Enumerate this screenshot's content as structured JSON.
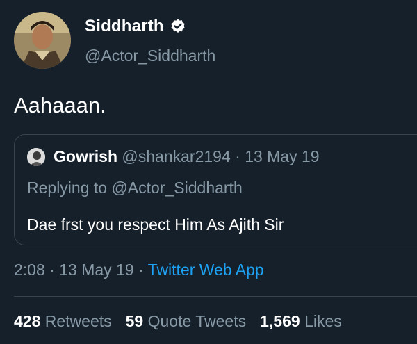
{
  "author": {
    "display_name": "Siddharth",
    "handle": "@Actor_Siddharth",
    "verified_icon": "verified-badge-icon"
  },
  "tweet": {
    "text": "Aahaaan."
  },
  "quoted_tweet": {
    "author_name": "Gowrish",
    "author_handle": "@shankar2194",
    "separator": "·",
    "date": "13 May 19",
    "replying_to": "Replying to @Actor_Siddharth",
    "text": "Dae frst you respect Him As Ajith Sir"
  },
  "meta": {
    "time": "2:08",
    "separator": "·",
    "date": "13 May 19",
    "source": "Twitter Web App"
  },
  "stats": {
    "retweets_count": "428",
    "retweets_label": "Retweets",
    "quotes_count": "59",
    "quotes_label": "Quote Tweets",
    "likes_count": "1,569",
    "likes_label": "Likes"
  },
  "colors": {
    "background": "#15202b",
    "secondary_text": "#8899a6",
    "link": "#1da1f2",
    "border": "#38444d"
  }
}
